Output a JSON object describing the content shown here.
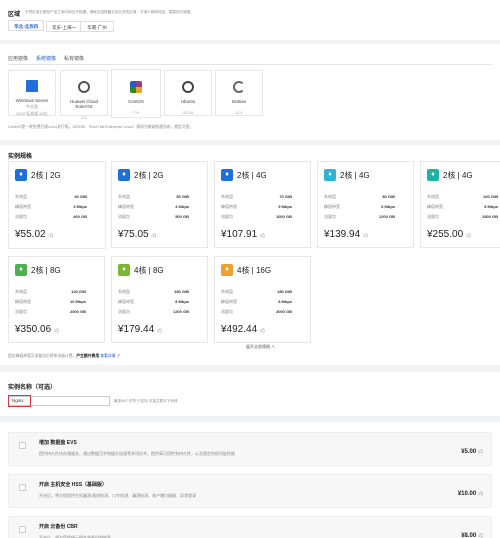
{
  "region": {
    "title": "区域",
    "hint": "不同区域云服务产品之间内网互不相通；请就近选择靠近您业务的区域，可减少网络时延、提高访问速度。",
    "options": [
      {
        "label": "华北-北京四",
        "selected": true
      },
      {
        "label": "华东-上海一",
        "selected": false
      },
      {
        "label": "华南-广州",
        "selected": false
      }
    ]
  },
  "image": {
    "tabs": [
      "应用镜像",
      "系统镜像",
      "私有镜像"
    ],
    "active_tab": 1,
    "os": [
      {
        "name": "Windows Server",
        "sub": "中文版",
        "ver": "2022 标准版 64位",
        "icon": "windows-icon",
        "color": "#1e6fd9"
      },
      {
        "name": "Huawei Cloud EulerOS",
        "ver": "2.0",
        "icon": "euleros-icon",
        "color": "#555555"
      },
      {
        "name": "CentOS",
        "ver": "7.9",
        "icon": "centos-icon",
        "color": "#8b3a8b",
        "selected": true
      },
      {
        "name": "Ubuntu",
        "ver": "22.04",
        "icon": "ubuntu-icon",
        "color": "#444444"
      },
      {
        "name": "Debian",
        "ver": "11.1",
        "icon": "debian-icon",
        "color": "#666666"
      }
    ],
    "note": "CentOS是一款免费开源Linux发行版，以RHEL（Red Hat Enterprise Linux）源码为基础构建而成，稳定可靠。"
  },
  "spec": {
    "title": "实例规格",
    "labels": {
      "disk": "系统盘",
      "bw": "峰值带宽",
      "traffic": "流量包",
      "unit": "/月"
    },
    "cards": [
      {
        "name": "2核 | 2G",
        "disk": "40 GiB",
        "bw": "3 Mbps",
        "traffic": "400 GB",
        "price": "¥55.02",
        "color": "#1e6fd9",
        "selected": true
      },
      {
        "name": "2核 | 2G",
        "disk": "50 GiB",
        "bw": "4 Mbps",
        "traffic": "500 GB",
        "price": "¥75.05",
        "color": "#1e6fd9"
      },
      {
        "name": "2核 | 4G",
        "disk": "70 GiB",
        "bw": "5 Mbps",
        "traffic": "1000 GB",
        "price": "¥107.91",
        "color": "#1e6fd9"
      },
      {
        "name": "2核 | 4G",
        "disk": "80 GiB",
        "bw": "6 Mbps",
        "traffic": "1200 GB",
        "price": "¥139.94",
        "color": "#2bb4d8"
      },
      {
        "name": "2核 | 4G",
        "disk": "100 GiB",
        "bw": "8 Mbps",
        "traffic": "1500 GB",
        "price": "¥255.00",
        "color": "#1ab3a6"
      },
      {
        "name": "2核 | 8G",
        "disk": "120 GiB",
        "bw": "10 Mbps",
        "traffic": "2000 GB",
        "price": "¥350.06",
        "color": "#4caf50"
      },
      {
        "name": "4核 | 8G",
        "disk": "180 GiB",
        "bw": "8 Mbps",
        "traffic": "1200 GB",
        "price": "¥179.44",
        "color": "#7cb82f"
      },
      {
        "name": "4核 | 16G",
        "disk": "180 GiB",
        "bw": "8 Mbps",
        "traffic": "2000 GB",
        "price": "¥492.44",
        "color": "#f0a030"
      }
    ],
    "collapse": "展开全部规格 ∧",
    "footnote": "超出峰值带宽及流量包后将按流量计费，",
    "footnote_bold": "产生额外费用",
    "footnote_link": "查看详情"
  },
  "name": {
    "title": "实例名称（可选）",
    "value": "Nginx",
    "hint": "最多66个字符 只支持 中英文数字下划线"
  },
  "addons": [
    {
      "title": "增加 数据盘 EVS",
      "desc": "提供持久性块存储服务，通过数据冗余和缓存加速等多项技术，提供高可用性和持久性，以及稳定的低时延性能",
      "price": "¥5.00",
      "unit": "/月"
    },
    {
      "title": "开启 主机安全 HSS（基础版）",
      "desc": "开启后，将为您提供主机漏洞/基线检测、口令检测、漏洞检测、账户爆力破解、异常登录",
      "price": "¥10.00",
      "unit": "/月"
    },
    {
      "title": "开启 云备份 CBR",
      "desc": "开启后，将为您提供云服务器备份和恢复",
      "price": "¥8.00",
      "unit": "/月"
    }
  ]
}
